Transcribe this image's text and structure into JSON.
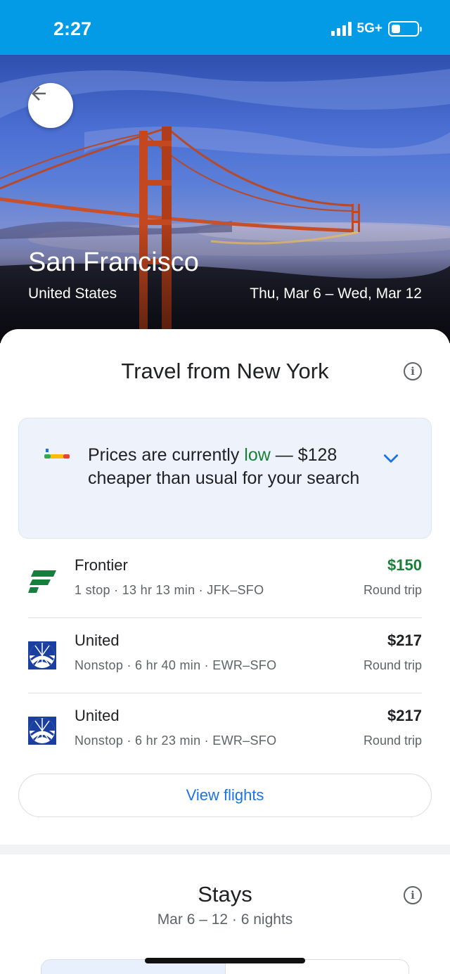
{
  "status_bar": {
    "time": "2:27",
    "network": "5G+"
  },
  "hero": {
    "city": "San Francisco",
    "country": "United States",
    "dates": "Thu, Mar 6 – Wed, Mar 12",
    "back_icon": "arrow-left-icon"
  },
  "flights_section": {
    "title": "Travel from New York",
    "info_icon": "info-icon",
    "price_insight": {
      "before_highlight": "Prices are currently ",
      "highlight": "low",
      "after_highlight": " — $128 cheaper than usual for your search",
      "highlight_color": "#188038",
      "icon": "price-indicator-icon"
    },
    "flights": [
      {
        "airline": "Frontier",
        "details": "1 stop · 13 hr 13 min · JFK–SFO",
        "price": "$150",
        "trip": "Round trip",
        "price_color": "#188038",
        "logo": "frontier-logo-icon"
      },
      {
        "airline": "United",
        "details": "Nonstop · 6 hr 40 min · EWR–SFO",
        "price": "$217",
        "trip": "Round trip",
        "price_color": "#202124",
        "logo": "united-logo-icon"
      },
      {
        "airline": "United",
        "details": "Nonstop · 6 hr 23 min · EWR–SFO",
        "price": "$217",
        "trip": "Round trip",
        "price_color": "#202124",
        "logo": "united-logo-icon"
      }
    ],
    "view_button": "View flights"
  },
  "stays_section": {
    "title": "Stays",
    "subtitle": "Mar 6 – 12 · 6 nights"
  },
  "colors": {
    "status_bar": "#039be5",
    "link": "#1a73e8",
    "card_bg": "#eef3fb"
  }
}
